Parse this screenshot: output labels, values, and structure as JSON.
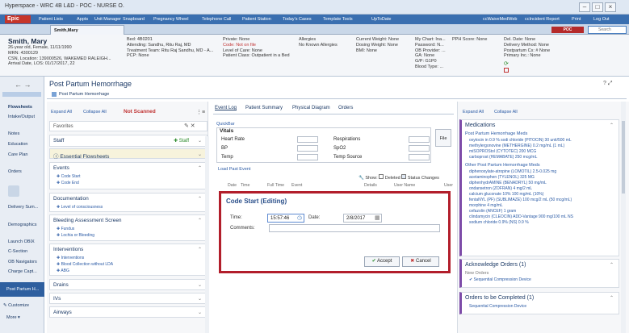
{
  "window": {
    "title": "Hyperspace - WRC 4B L&D - POC - NURSE O."
  },
  "menubar": {
    "epic": "Epic",
    "items": [
      "Patient Lists",
      "Appts",
      "Unit Manager",
      "Snapboard",
      "Pregnancy Wheel",
      "Telephone Call",
      "Patient Station",
      "Today's Cases",
      "Template Tools",
      "UpToDate",
      "ccWaiveMedWeb",
      "ccIncident Report",
      "Print",
      "Log Out"
    ]
  },
  "patient_tab": {
    "name": "Smith,Mary",
    "poc": "POC",
    "search_placeholder": "Search"
  },
  "header": {
    "name": "Smith, Mary",
    "demo": [
      "26-year old, Female, 11/11/1990",
      "MRN: 4300129",
      "CSN, Location: 139000526, WAKEMED RALEIGH...",
      "Arrival Date, LOS: 01/17/2017, 22"
    ],
    "col2": [
      "Bed: 4B0201",
      "Attending: Sandhu, Ritu Raj, MD",
      "Treatment Team: Ritu Raj Sandhu, MD - A...",
      "PCP: None"
    ],
    "col3": [
      "Private: None",
      "Code: Not on file",
      "Level of Care: None",
      "Patient Class: Outpatient in a Bed"
    ],
    "col4": [
      "Allergies",
      "No Known Allergies"
    ],
    "col5": [
      "Current Weight: None",
      "Dosing Weight: None",
      "BMI: None"
    ],
    "col6": [
      "My Chart: Ina...",
      "Password: N...",
      "OB Provider: ...",
      "GA: None",
      "G/P: G1P0",
      "Blood Type: ..."
    ],
    "col6b": "PPH Score: None",
    "col7": [
      "Del. Date: None",
      "Delivery Method: None",
      "Postpartum Cs: # None",
      "Primary Inc.: None"
    ]
  },
  "leftnav": {
    "items": [
      "Flowsheets",
      "Intake/Output",
      "Notes",
      "Education",
      "Care Plan",
      "Orders",
      "Delivery Sum...",
      "Demographics",
      "Launch OBIX",
      "C-Section",
      "OB Navigators",
      "Charge Capt...",
      "Post Partum H..."
    ],
    "customize": "Customize",
    "more": "More"
  },
  "activity": {
    "title": "Post Partum Hemorrhage",
    "subtitle": "Post Partum Hemorrhage",
    "expand_all": "Expand All",
    "collapse_all": "Collapse All",
    "not_scanned": "Not Scanned",
    "favorites": "Favorites",
    "sections": [
      {
        "title": "Staff",
        "items": []
      },
      {
        "title": "Essential Flowsheets",
        "items": []
      },
      {
        "title": "Events",
        "items": [
          "Code Start",
          "Code End"
        ]
      },
      {
        "title": "Documentation",
        "items": [
          "Level of consciousness"
        ]
      },
      {
        "title": "Bleeding Assessment Screen",
        "items": [
          "Fundus",
          "Lochia or Bleeding"
        ]
      },
      {
        "title": "Interventions",
        "items": [
          "Interventions",
          "Blood Collection without LDA",
          "ABG"
        ]
      },
      {
        "title": "Drains",
        "items": []
      },
      {
        "title": "IVs",
        "items": []
      },
      {
        "title": "Airways",
        "items": []
      }
    ],
    "staff_btn": "Staff"
  },
  "middle": {
    "tabs": [
      "Event Log",
      "Patient Summary",
      "Physical Diagram",
      "Orders"
    ],
    "quickbar": "QuickBar",
    "vitals_title": "Vitals",
    "vitals": [
      "Heart Rate",
      "Respirations",
      "BP",
      "SpO2",
      "Temp",
      "Temp Source"
    ],
    "file": "File",
    "load_past": "Load Past Event",
    "show": "Show:",
    "deleted": "Deleted",
    "status_changes": "Status Changes",
    "columns": [
      "Date",
      "Time",
      "Full Time",
      "Event",
      "Details",
      "User Name",
      "User"
    ]
  },
  "dialog": {
    "title": "Code Start (Editing)",
    "time_label": "Time:",
    "time_value": "15:57:46",
    "date_label": "Date:",
    "date_value": "2/8/2017",
    "comments_label": "Comments:",
    "accept": "Accept",
    "cancel": "Cancel"
  },
  "right": {
    "expand_all": "Expand All",
    "collapse_all": "Collapse All",
    "medications": "Medications",
    "meds_group1": "Post Partum Hemorrhage Meds",
    "meds1": [
      "oxytocin in 0.9 % sodi chloride (PITOCIN) 30 unit/500 mL",
      "methylergonovine (METHERGINE) 0.2 mg/mL (1 mL)",
      "miSOPROStol (CYTOTEC) 200 MCG",
      "carboprost (HEMABATE) 250 mcg/mL"
    ],
    "meds_group2": "Other Post Partum Hemorrhage Meds",
    "meds2": [
      "diphenoxylate-atropine (LOMOTIL) 2.5-0.025 mg",
      "acetaminophen (TYLENOL) 325 MG",
      "diphenhydrAMINE (BENADRYL) 50 mg/mL",
      "ondansetron (ZOFRAN) 4 mg/2 mL",
      "calcium gluconate 10% 100 mg/mL (10%)",
      "fentaNYL (PF) (SUBLIMAZE) 100 mcg/2 mL (50 mcg/mL)",
      "morphine 4 mg/mL",
      "cefazolin (ANCEF) 1 gram",
      "clindamycin (CLEOCIN) ADD-Vantage 900 mg/100 mL NS",
      "sodium chloride 0.9% (NS) 0.9 %"
    ],
    "ack_title": "Acknowledge Orders (1)",
    "new_orders": "New Orders",
    "ack_item": "Sequential Compression Device",
    "complete_title": "Orders to be Completed (1)",
    "complete_item": "Sequential Compression Device"
  }
}
